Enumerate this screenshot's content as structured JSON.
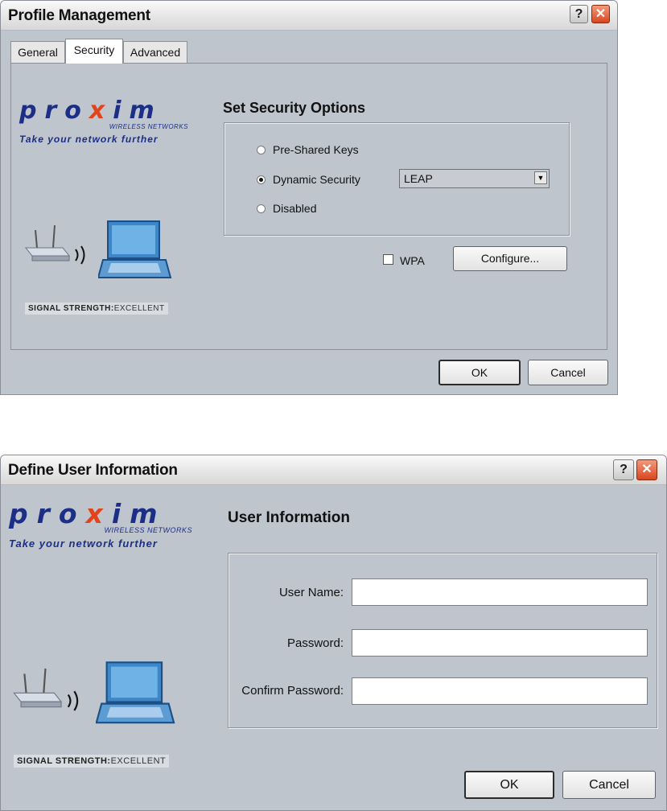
{
  "dialog1": {
    "title": "Profile Management",
    "tabs": [
      "General",
      "Security",
      "Advanced"
    ],
    "section_title": "Set Security Options",
    "options": [
      {
        "label": "Pre-Shared Keys",
        "selected": false
      },
      {
        "label": "Dynamic Security",
        "selected": true
      },
      {
        "label": "Disabled",
        "selected": false
      }
    ],
    "security_type": "LEAP",
    "wpa_label": "WPA",
    "wpa_checked": false,
    "configure_label": "Configure...",
    "ok_label": "OK",
    "cancel_label": "Cancel"
  },
  "dialog2": {
    "title": "Define User Information",
    "section_title": "User Information",
    "fields": [
      {
        "label": "User Name:",
        "value": ""
      },
      {
        "label": "Password:",
        "value": ""
      },
      {
        "label": "Confirm Password:",
        "value": ""
      }
    ],
    "ok_label": "OK",
    "cancel_label": "Cancel"
  },
  "brand": {
    "logo_left": "pro",
    "logo_x": "x",
    "logo_right": "im",
    "logo_sub": "WIRELESS NETWORKS",
    "tagline": "Take your network further",
    "signal_label": "SIGNAL STRENGTH:",
    "signal_value": "EXCELLENT"
  },
  "icons": [
    "help-icon",
    "close-icon",
    "access-point-icon",
    "laptop-icon",
    "dropdown-arrow-icon"
  ],
  "colors": {
    "dialog_bg": "#bfc5cd",
    "brand_blue": "#1c2e86",
    "brand_orange": "#e2431c",
    "close_red": "#d9461e"
  }
}
